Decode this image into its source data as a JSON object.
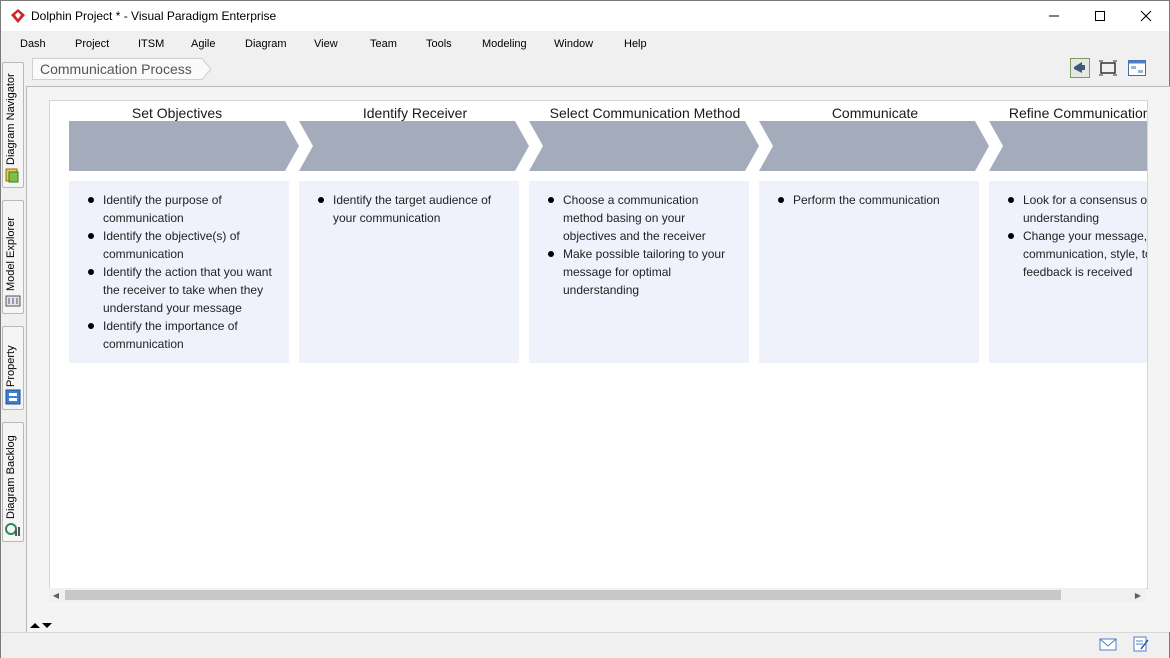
{
  "window": {
    "title": "Dolphin Project * - Visual Paradigm Enterprise"
  },
  "menu": [
    "Dash",
    "Project",
    "ITSM",
    "Agile",
    "Diagram",
    "View",
    "Team",
    "Tools",
    "Modeling",
    "Window",
    "Help"
  ],
  "side_tabs": [
    "Diagram Navigator",
    "Model Explorer",
    "Property",
    "Diagram Backlog"
  ],
  "breadcrumb": {
    "label": "Communication Process"
  },
  "colors": {
    "chevron": "#a4abba",
    "card": "#eff2fb",
    "accent_red": "#c8282c"
  },
  "diagram": {
    "steps": [
      {
        "title": "Set Objectives",
        "items": [
          "Identify the purpose of communication",
          "Identify the objective(s) of communication",
          "Identify the action that you want the receiver to take when they understand your message",
          "Identify the importance of communication"
        ]
      },
      {
        "title": "Identify Receiver",
        "items": [
          "Identify the target audience of your communication"
        ]
      },
      {
        "title": "Select Communication Method",
        "items": [
          "Choose a communication method basing on your objectives and the receiver",
          "Make possible tailoring to your message for optimal understanding"
        ]
      },
      {
        "title": "Communicate",
        "items": [
          "Perform the communication"
        ]
      },
      {
        "title": "Refine Communication Method",
        "items": [
          "Look for a consensus of understanding",
          "Change your message, communication, style, tone as feedback is received"
        ]
      }
    ]
  }
}
